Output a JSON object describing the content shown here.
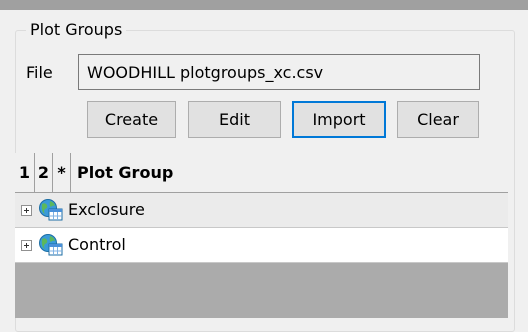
{
  "panel": {
    "title": "Plot Groups",
    "file_label": "File",
    "file_value": "WOODHILL plotgroups_xc.csv"
  },
  "buttons": {
    "create": "Create",
    "edit": "Edit",
    "import": "Import",
    "clear": "Clear"
  },
  "table": {
    "columns": [
      "1",
      "2",
      "*",
      "Plot Group"
    ],
    "rows": [
      {
        "label": "Exclosure",
        "icon": "globe-table-icon"
      },
      {
        "label": "Control",
        "icon": "globe-table-icon"
      }
    ]
  },
  "colors": {
    "focus": "#0078d7",
    "grid_empty": "#ababab"
  }
}
